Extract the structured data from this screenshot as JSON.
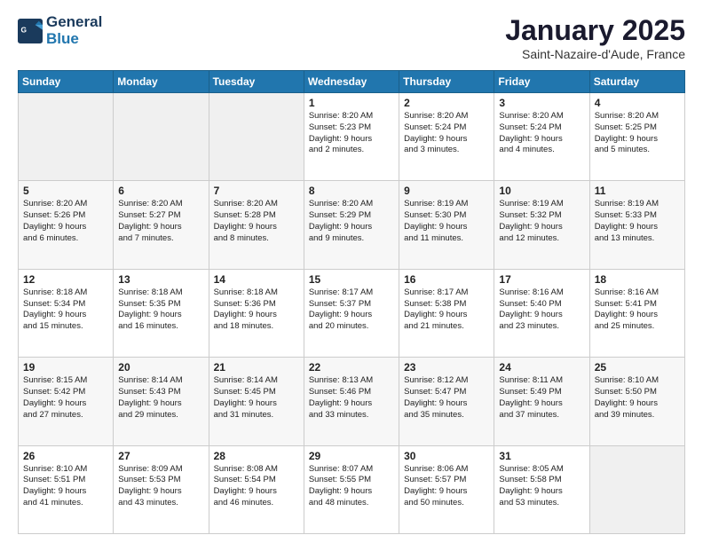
{
  "header": {
    "logo_line1": "General",
    "logo_line2": "Blue",
    "title": "January 2025",
    "subtitle": "Saint-Nazaire-d'Aude, France"
  },
  "days_of_week": [
    "Sunday",
    "Monday",
    "Tuesday",
    "Wednesday",
    "Thursday",
    "Friday",
    "Saturday"
  ],
  "weeks": [
    [
      {
        "day": "",
        "info": ""
      },
      {
        "day": "",
        "info": ""
      },
      {
        "day": "",
        "info": ""
      },
      {
        "day": "1",
        "info": "Sunrise: 8:20 AM\nSunset: 5:23 PM\nDaylight: 9 hours\nand 2 minutes."
      },
      {
        "day": "2",
        "info": "Sunrise: 8:20 AM\nSunset: 5:24 PM\nDaylight: 9 hours\nand 3 minutes."
      },
      {
        "day": "3",
        "info": "Sunrise: 8:20 AM\nSunset: 5:24 PM\nDaylight: 9 hours\nand 4 minutes."
      },
      {
        "day": "4",
        "info": "Sunrise: 8:20 AM\nSunset: 5:25 PM\nDaylight: 9 hours\nand 5 minutes."
      }
    ],
    [
      {
        "day": "5",
        "info": "Sunrise: 8:20 AM\nSunset: 5:26 PM\nDaylight: 9 hours\nand 6 minutes."
      },
      {
        "day": "6",
        "info": "Sunrise: 8:20 AM\nSunset: 5:27 PM\nDaylight: 9 hours\nand 7 minutes."
      },
      {
        "day": "7",
        "info": "Sunrise: 8:20 AM\nSunset: 5:28 PM\nDaylight: 9 hours\nand 8 minutes."
      },
      {
        "day": "8",
        "info": "Sunrise: 8:20 AM\nSunset: 5:29 PM\nDaylight: 9 hours\nand 9 minutes."
      },
      {
        "day": "9",
        "info": "Sunrise: 8:19 AM\nSunset: 5:30 PM\nDaylight: 9 hours\nand 11 minutes."
      },
      {
        "day": "10",
        "info": "Sunrise: 8:19 AM\nSunset: 5:32 PM\nDaylight: 9 hours\nand 12 minutes."
      },
      {
        "day": "11",
        "info": "Sunrise: 8:19 AM\nSunset: 5:33 PM\nDaylight: 9 hours\nand 13 minutes."
      }
    ],
    [
      {
        "day": "12",
        "info": "Sunrise: 8:18 AM\nSunset: 5:34 PM\nDaylight: 9 hours\nand 15 minutes."
      },
      {
        "day": "13",
        "info": "Sunrise: 8:18 AM\nSunset: 5:35 PM\nDaylight: 9 hours\nand 16 minutes."
      },
      {
        "day": "14",
        "info": "Sunrise: 8:18 AM\nSunset: 5:36 PM\nDaylight: 9 hours\nand 18 minutes."
      },
      {
        "day": "15",
        "info": "Sunrise: 8:17 AM\nSunset: 5:37 PM\nDaylight: 9 hours\nand 20 minutes."
      },
      {
        "day": "16",
        "info": "Sunrise: 8:17 AM\nSunset: 5:38 PM\nDaylight: 9 hours\nand 21 minutes."
      },
      {
        "day": "17",
        "info": "Sunrise: 8:16 AM\nSunset: 5:40 PM\nDaylight: 9 hours\nand 23 minutes."
      },
      {
        "day": "18",
        "info": "Sunrise: 8:16 AM\nSunset: 5:41 PM\nDaylight: 9 hours\nand 25 minutes."
      }
    ],
    [
      {
        "day": "19",
        "info": "Sunrise: 8:15 AM\nSunset: 5:42 PM\nDaylight: 9 hours\nand 27 minutes."
      },
      {
        "day": "20",
        "info": "Sunrise: 8:14 AM\nSunset: 5:43 PM\nDaylight: 9 hours\nand 29 minutes."
      },
      {
        "day": "21",
        "info": "Sunrise: 8:14 AM\nSunset: 5:45 PM\nDaylight: 9 hours\nand 31 minutes."
      },
      {
        "day": "22",
        "info": "Sunrise: 8:13 AM\nSunset: 5:46 PM\nDaylight: 9 hours\nand 33 minutes."
      },
      {
        "day": "23",
        "info": "Sunrise: 8:12 AM\nSunset: 5:47 PM\nDaylight: 9 hours\nand 35 minutes."
      },
      {
        "day": "24",
        "info": "Sunrise: 8:11 AM\nSunset: 5:49 PM\nDaylight: 9 hours\nand 37 minutes."
      },
      {
        "day": "25",
        "info": "Sunrise: 8:10 AM\nSunset: 5:50 PM\nDaylight: 9 hours\nand 39 minutes."
      }
    ],
    [
      {
        "day": "26",
        "info": "Sunrise: 8:10 AM\nSunset: 5:51 PM\nDaylight: 9 hours\nand 41 minutes."
      },
      {
        "day": "27",
        "info": "Sunrise: 8:09 AM\nSunset: 5:53 PM\nDaylight: 9 hours\nand 43 minutes."
      },
      {
        "day": "28",
        "info": "Sunrise: 8:08 AM\nSunset: 5:54 PM\nDaylight: 9 hours\nand 46 minutes."
      },
      {
        "day": "29",
        "info": "Sunrise: 8:07 AM\nSunset: 5:55 PM\nDaylight: 9 hours\nand 48 minutes."
      },
      {
        "day": "30",
        "info": "Sunrise: 8:06 AM\nSunset: 5:57 PM\nDaylight: 9 hours\nand 50 minutes."
      },
      {
        "day": "31",
        "info": "Sunrise: 8:05 AM\nSunset: 5:58 PM\nDaylight: 9 hours\nand 53 minutes."
      },
      {
        "day": "",
        "info": ""
      }
    ]
  ]
}
